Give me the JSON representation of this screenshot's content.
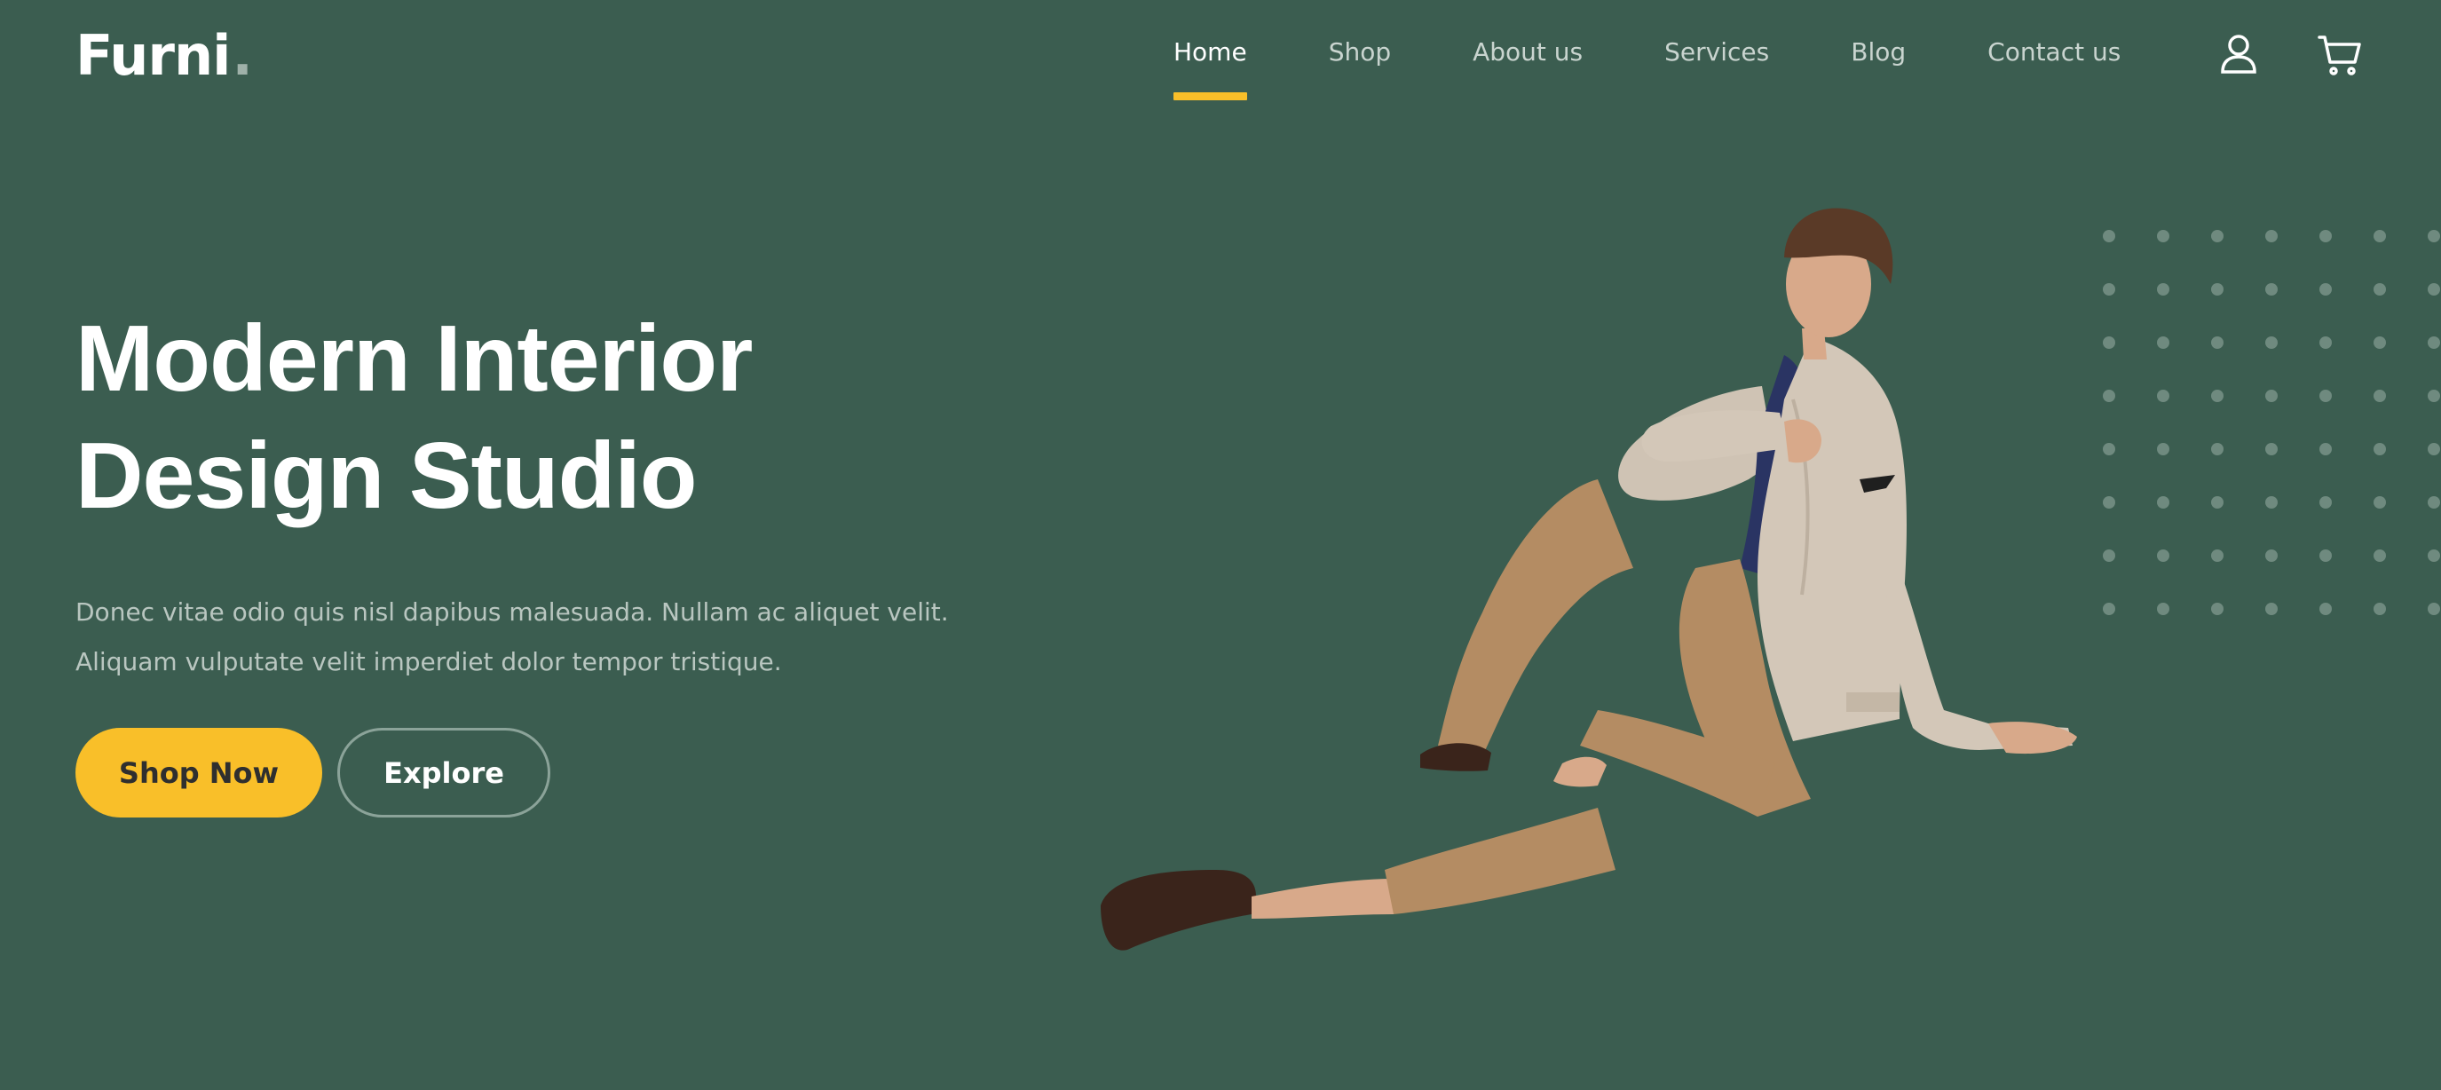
{
  "brand": {
    "name": "Furni",
    "dot": "."
  },
  "nav": {
    "items": [
      {
        "label": "Home",
        "active": true
      },
      {
        "label": "Shop",
        "active": false
      },
      {
        "label": "About us",
        "active": false
      },
      {
        "label": "Services",
        "active": false
      },
      {
        "label": "Blog",
        "active": false
      },
      {
        "label": "Contact us",
        "active": false
      }
    ]
  },
  "header_icons": {
    "account": "user-icon",
    "cart": "cart-icon"
  },
  "hero": {
    "title_line1": "Modern Interior",
    "title_line2": "Design Studio",
    "desc_line1": "Donec vitae odio quis nisl dapibus malesuada. Nullam ac aliquet velit.",
    "desc_line2": "Aliquam vulputate velit imperdiet dolor tempor tristique.",
    "primary_button": "Shop Now",
    "secondary_button": "Explore"
  },
  "colors": {
    "background": "#3b5d50",
    "accent": "#f9bf29",
    "nav_inactive": "#c9d4cf",
    "text_muted": "#b9c6c0"
  }
}
